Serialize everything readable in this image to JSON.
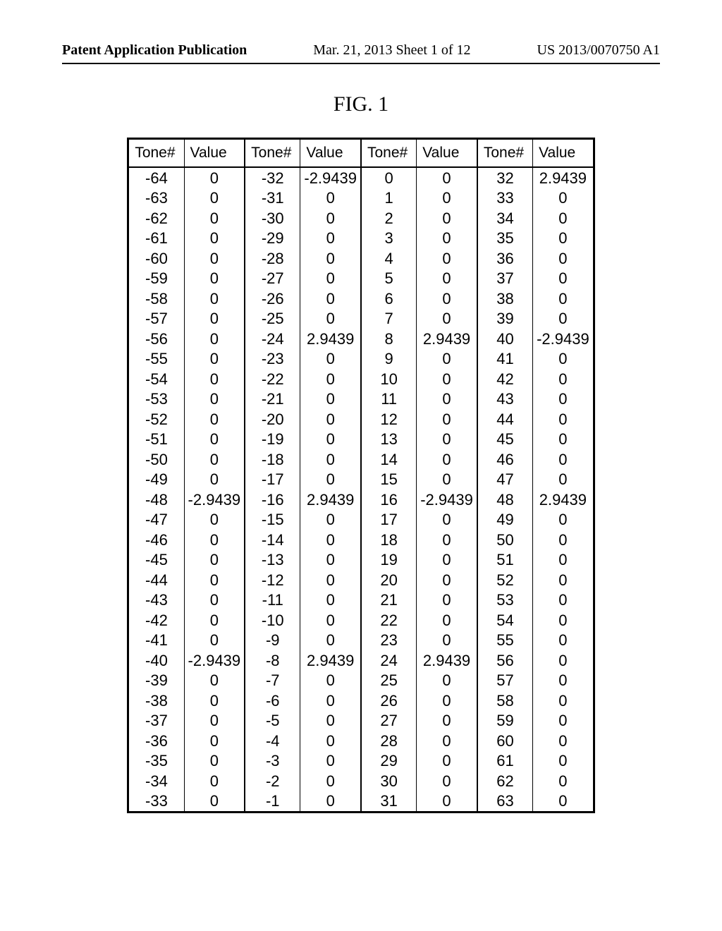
{
  "header": {
    "left": "Patent Application Publication",
    "mid": "Mar. 21, 2013  Sheet 1 of 12",
    "right": "US 2013/0070750 A1"
  },
  "figure_title": "FIG. 1",
  "columns": {
    "tone": "Tone#",
    "value": "Value"
  },
  "groups": [
    {
      "rows": [
        {
          "t": "-64",
          "v": "0"
        },
        {
          "t": "-63",
          "v": "0"
        },
        {
          "t": "-62",
          "v": "0"
        },
        {
          "t": "-61",
          "v": "0"
        },
        {
          "t": "-60",
          "v": "0"
        },
        {
          "t": "-59",
          "v": "0"
        },
        {
          "t": "-58",
          "v": "0"
        },
        {
          "t": "-57",
          "v": "0"
        },
        {
          "t": "-56",
          "v": "0"
        },
        {
          "t": "-55",
          "v": "0"
        },
        {
          "t": "-54",
          "v": "0"
        },
        {
          "t": "-53",
          "v": "0"
        },
        {
          "t": "-52",
          "v": "0"
        },
        {
          "t": "-51",
          "v": "0"
        },
        {
          "t": "-50",
          "v": "0"
        },
        {
          "t": "-49",
          "v": "0"
        },
        {
          "t": "-48",
          "v": "-2.9439"
        },
        {
          "t": "-47",
          "v": "0"
        },
        {
          "t": "-46",
          "v": "0"
        },
        {
          "t": "-45",
          "v": "0"
        },
        {
          "t": "-44",
          "v": "0"
        },
        {
          "t": "-43",
          "v": "0"
        },
        {
          "t": "-42",
          "v": "0"
        },
        {
          "t": "-41",
          "v": "0"
        },
        {
          "t": "-40",
          "v": "-2.9439"
        },
        {
          "t": "-39",
          "v": "0"
        },
        {
          "t": "-38",
          "v": "0"
        },
        {
          "t": "-37",
          "v": "0"
        },
        {
          "t": "-36",
          "v": "0"
        },
        {
          "t": "-35",
          "v": "0"
        },
        {
          "t": "-34",
          "v": "0"
        },
        {
          "t": "-33",
          "v": "0"
        }
      ]
    },
    {
      "rows": [
        {
          "t": "-32",
          "v": "-2.9439"
        },
        {
          "t": "-31",
          "v": "0"
        },
        {
          "t": "-30",
          "v": "0"
        },
        {
          "t": "-29",
          "v": "0"
        },
        {
          "t": "-28",
          "v": "0"
        },
        {
          "t": "-27",
          "v": "0"
        },
        {
          "t": "-26",
          "v": "0"
        },
        {
          "t": "-25",
          "v": "0"
        },
        {
          "t": "-24",
          "v": "2.9439"
        },
        {
          "t": "-23",
          "v": "0"
        },
        {
          "t": "-22",
          "v": "0"
        },
        {
          "t": "-21",
          "v": "0"
        },
        {
          "t": "-20",
          "v": "0"
        },
        {
          "t": "-19",
          "v": "0"
        },
        {
          "t": "-18",
          "v": "0"
        },
        {
          "t": "-17",
          "v": "0"
        },
        {
          "t": "-16",
          "v": "2.9439"
        },
        {
          "t": "-15",
          "v": "0"
        },
        {
          "t": "-14",
          "v": "0"
        },
        {
          "t": "-13",
          "v": "0"
        },
        {
          "t": "-12",
          "v": "0"
        },
        {
          "t": "-11",
          "v": "0"
        },
        {
          "t": "-10",
          "v": "0"
        },
        {
          "t": "-9",
          "v": "0"
        },
        {
          "t": "-8",
          "v": "2.9439"
        },
        {
          "t": "-7",
          "v": "0"
        },
        {
          "t": "-6",
          "v": "0"
        },
        {
          "t": "-5",
          "v": "0"
        },
        {
          "t": "-4",
          "v": "0"
        },
        {
          "t": "-3",
          "v": "0"
        },
        {
          "t": "-2",
          "v": "0"
        },
        {
          "t": "-1",
          "v": "0"
        }
      ]
    },
    {
      "rows": [
        {
          "t": "0",
          "v": "0"
        },
        {
          "t": "1",
          "v": "0"
        },
        {
          "t": "2",
          "v": "0"
        },
        {
          "t": "3",
          "v": "0"
        },
        {
          "t": "4",
          "v": "0"
        },
        {
          "t": "5",
          "v": "0"
        },
        {
          "t": "6",
          "v": "0"
        },
        {
          "t": "7",
          "v": "0"
        },
        {
          "t": "8",
          "v": "2.9439"
        },
        {
          "t": "9",
          "v": "0"
        },
        {
          "t": "10",
          "v": "0"
        },
        {
          "t": "11",
          "v": "0"
        },
        {
          "t": "12",
          "v": "0"
        },
        {
          "t": "13",
          "v": "0"
        },
        {
          "t": "14",
          "v": "0"
        },
        {
          "t": "15",
          "v": "0"
        },
        {
          "t": "16",
          "v": "-2.9439"
        },
        {
          "t": "17",
          "v": "0"
        },
        {
          "t": "18",
          "v": "0"
        },
        {
          "t": "19",
          "v": "0"
        },
        {
          "t": "20",
          "v": "0"
        },
        {
          "t": "21",
          "v": "0"
        },
        {
          "t": "22",
          "v": "0"
        },
        {
          "t": "23",
          "v": "0"
        },
        {
          "t": "24",
          "v": "2.9439"
        },
        {
          "t": "25",
          "v": "0"
        },
        {
          "t": "26",
          "v": "0"
        },
        {
          "t": "27",
          "v": "0"
        },
        {
          "t": "28",
          "v": "0"
        },
        {
          "t": "29",
          "v": "0"
        },
        {
          "t": "30",
          "v": "0"
        },
        {
          "t": "31",
          "v": "0"
        }
      ]
    },
    {
      "rows": [
        {
          "t": "32",
          "v": "2.9439"
        },
        {
          "t": "33",
          "v": "0"
        },
        {
          "t": "34",
          "v": "0"
        },
        {
          "t": "35",
          "v": "0"
        },
        {
          "t": "36",
          "v": "0"
        },
        {
          "t": "37",
          "v": "0"
        },
        {
          "t": "38",
          "v": "0"
        },
        {
          "t": "39",
          "v": "0"
        },
        {
          "t": "40",
          "v": "-2.9439"
        },
        {
          "t": "41",
          "v": "0"
        },
        {
          "t": "42",
          "v": "0"
        },
        {
          "t": "43",
          "v": "0"
        },
        {
          "t": "44",
          "v": "0"
        },
        {
          "t": "45",
          "v": "0"
        },
        {
          "t": "46",
          "v": "0"
        },
        {
          "t": "47",
          "v": "0"
        },
        {
          "t": "48",
          "v": "2.9439"
        },
        {
          "t": "49",
          "v": "0"
        },
        {
          "t": "50",
          "v": "0"
        },
        {
          "t": "51",
          "v": "0"
        },
        {
          "t": "52",
          "v": "0"
        },
        {
          "t": "53",
          "v": "0"
        },
        {
          "t": "54",
          "v": "0"
        },
        {
          "t": "55",
          "v": "0"
        },
        {
          "t": "56",
          "v": "0"
        },
        {
          "t": "57",
          "v": "0"
        },
        {
          "t": "58",
          "v": "0"
        },
        {
          "t": "59",
          "v": "0"
        },
        {
          "t": "60",
          "v": "0"
        },
        {
          "t": "61",
          "v": "0"
        },
        {
          "t": "62",
          "v": "0"
        },
        {
          "t": "63",
          "v": "0"
        }
      ]
    }
  ]
}
